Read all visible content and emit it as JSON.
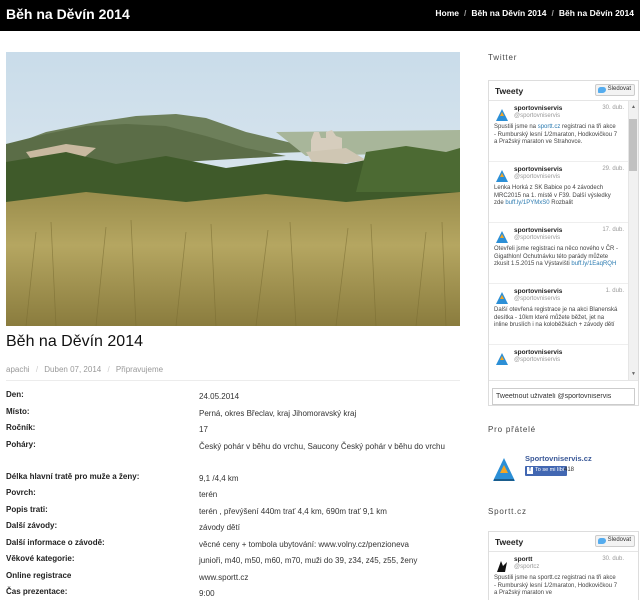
{
  "header": {
    "site_title": "Běh na Děvín 2014",
    "breadcrumb": [
      "Home",
      "Běh na Děvín 2014",
      "Běh na Děvín 2014"
    ]
  },
  "post": {
    "title": "Běh na Děvín 2014",
    "meta": {
      "author": "apachi",
      "date": "Duben 07, 2014",
      "category": "Připravujeme"
    },
    "details": [
      {
        "label": "Den:",
        "value": "24.05.2014"
      },
      {
        "label": "Místo:",
        "value": "Perná, okres Břeclav, kraj Jihomoravský kraj"
      },
      {
        "label": "Ročník:",
        "value": "17"
      },
      {
        "label": "Poháry:",
        "value": "Český pohár v běhu do vrchu, Saucony Český pohár v běhu do vrchu"
      },
      {
        "label": "Délka hlavní tratě pro muže a ženy:",
        "value": "9,1 /4,4 km"
      },
      {
        "label": "Povrch:",
        "value": "terén"
      },
      {
        "label": "Popis trati:",
        "value": "terén , převýšení 440m trať 4,4 km, 690m trať 9,1 km"
      },
      {
        "label": "Další závody:",
        "value": "závody dětí"
      },
      {
        "label": "Další informace o závodě:",
        "value": "věcné ceny + tombola ubytování: www.volny.cz/penzioneva"
      },
      {
        "label": "Věkové kategorie:",
        "value": "junioři, m40, m50, m60, m70, muži do 39, z34, z45, z55, ženy"
      },
      {
        "label": "Online registrace",
        "value": "www.sportt.cz"
      },
      {
        "label": "Čas prezentace:",
        "value": "9:00"
      }
    ]
  },
  "sidebar": {
    "twitter_heading": "Twitter",
    "twitter_widget": {
      "title": "Tweety",
      "follow_label": "Sledovat",
      "tweets": [
        {
          "name": "sportovniservis",
          "handle": "@sportovniservis",
          "date": "30. dub.",
          "text": "Spustili jsme na ",
          "link": "sportt.cz",
          "text2": " registraci na tři akce - Rumburský lesní 1/2maraton, Hodkovičkou 7 a Pražský maraton ve Strahovce."
        },
        {
          "name": "sportovniservis",
          "handle": "@sportovniservis",
          "date": "29. dub.",
          "text": "Lenka Horká z SK Babice po 4 závodech MRC2015 na 1. místě v F39. Další výsledky zde ",
          "link": "buff.ly/1PYMxS0",
          "text2": " Rozbalit"
        },
        {
          "name": "sportovniservis",
          "handle": "@sportovniservis",
          "date": "17. dub.",
          "text": "Otevřeli jsme registraci na něco nového v ČR - Gigathlon! Ochutnávku této parády můžete zkusit 1.5.2015 na Výstavišti ",
          "link": "buff.ly/1EaqRQH",
          "text2": ""
        },
        {
          "name": "sportovniservis",
          "handle": "@sportovniservis",
          "date": "1. dub.",
          "text": "Další otevřená registrace je na akci Blanenská desítka - 10km které můžete běžet, jet na inline bruslích i na koloběžkách + závody dětí",
          "link": "",
          "text2": ""
        },
        {
          "name": "sportovniservis",
          "handle": "@sportovniservis",
          "date": "",
          "text": "",
          "link": "",
          "text2": ""
        }
      ],
      "input_value": "Tweetnout uživateli @sportovniservis"
    },
    "friends_heading": "Pro přátelé",
    "facebook": {
      "name": "Sportovniservis.cz",
      "like_label": "To se mi líbí",
      "count": "418"
    },
    "sportt_heading": "Sportt.cz",
    "sportt_widget": {
      "title": "Tweety",
      "follow_label": "Sledovat",
      "tweet": {
        "name": "sportt",
        "handle": "@sportcz",
        "date": "30. dub.",
        "text": "Spustili jsme na sportt.cz registraci na tři akce - Rumburský lesní 1/2maraton, Hodkovičkou 7 a Pražský maraton ve"
      }
    }
  }
}
